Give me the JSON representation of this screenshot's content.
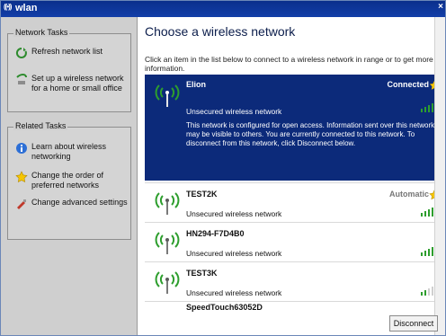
{
  "window": {
    "title": "wlan",
    "wifi_glyph": "((•))"
  },
  "sidebar": {
    "network_tasks": {
      "title": "Network Tasks",
      "items": [
        {
          "label": "Refresh network list",
          "icon": "refresh-icon"
        },
        {
          "label": "Set up a wireless network for a home or small office",
          "icon": "setup-network-icon"
        }
      ]
    },
    "related_tasks": {
      "title": "Related Tasks",
      "items": [
        {
          "label": "Learn about wireless networking",
          "icon": "info-icon"
        },
        {
          "label": "Change the order of preferred networks",
          "icon": "star-icon"
        },
        {
          "label": "Change advanced settings",
          "icon": "settings-icon"
        }
      ]
    }
  },
  "main": {
    "heading": "Choose a wireless network",
    "intro": "Click an item in the list below to connect to a wireless network in range or to get more information.",
    "networks": [
      {
        "name": "Elion",
        "status": "Connected",
        "type": "Unsecured wireless network",
        "description": "This network is configured for open access. Information sent over this network may be visible to others. You are currently connected to this network. To disconnect from this network, click Disconnect below.",
        "signal_bars": 5
      },
      {
        "name": "TEST2K",
        "status": "Automatic",
        "type": "Unsecured wireless network",
        "signal_bars": 4
      },
      {
        "name": "HN294-F7D4B0",
        "status": "",
        "type": "Unsecured wireless network",
        "signal_bars": 4
      },
      {
        "name": "TEST3K",
        "status": "",
        "type": "Unsecured wireless network",
        "signal_bars": 2
      },
      {
        "name": "SpeedTouch63052D",
        "status": "",
        "type": "",
        "signal_bars": 1
      }
    ],
    "disconnect_button": "Disconnect"
  },
  "colors": {
    "titlebar": "#0a2f8c",
    "selected_row": "#0c2a7a",
    "sidebar_bg": "#cfcfcf",
    "signal_green": "#2d9e2d",
    "star_yellow": "#f6c600"
  }
}
